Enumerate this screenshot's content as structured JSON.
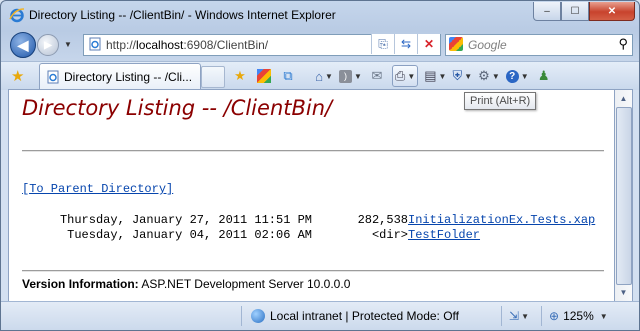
{
  "window": {
    "title": "Directory Listing -- /ClientBin/ - Windows Internet Explorer",
    "minimize": "–",
    "maximize": "☐",
    "close": "✕"
  },
  "nav": {
    "url_prefix": "http://",
    "url_host": "localhost",
    "url_rest": ":6908/ClientBin/",
    "search_placeholder": "Google"
  },
  "tab": {
    "label": "Directory Listing -- /Cli..."
  },
  "tooltip": "Print (Alt+R)",
  "page": {
    "heading": "Directory Listing -- /ClientBin/",
    "parent_link": "[To Parent Directory]",
    "entries": [
      {
        "date": "Thursday, January 27, 2011 11:51 PM",
        "size": "282,538",
        "name": "InitializationEx.Tests.xap"
      },
      {
        "date": "Tuesday, January 04, 2011 02:06 AM",
        "size": "<dir>",
        "name": "TestFolder"
      }
    ],
    "version_label": "Version Information:",
    "version_value": "ASP.NET Development Server 10.0.0.0"
  },
  "status": {
    "zone": "Local intranet | Protected Mode: Off",
    "zoom": "125%"
  },
  "colors": {
    "heading": "#8b0000",
    "link": "#0645ad"
  },
  "icons": [
    "ie-logo-icon",
    "back-arrow-icon",
    "forward-arrow-icon",
    "page-icon",
    "compatibility-view-icon",
    "refresh-icon",
    "stop-icon",
    "google-icon",
    "search-icon",
    "favorites-star-icon",
    "add-favorites-icon",
    "suggested-sites-icon",
    "web-slice-icon",
    "home-icon",
    "rss-feed-icon",
    "read-mail-icon",
    "print-icon",
    "page-menu-icon",
    "safety-icon",
    "tools-gear-icon",
    "help-icon",
    "research-icon",
    "globe-icon",
    "zoom-icon"
  ]
}
